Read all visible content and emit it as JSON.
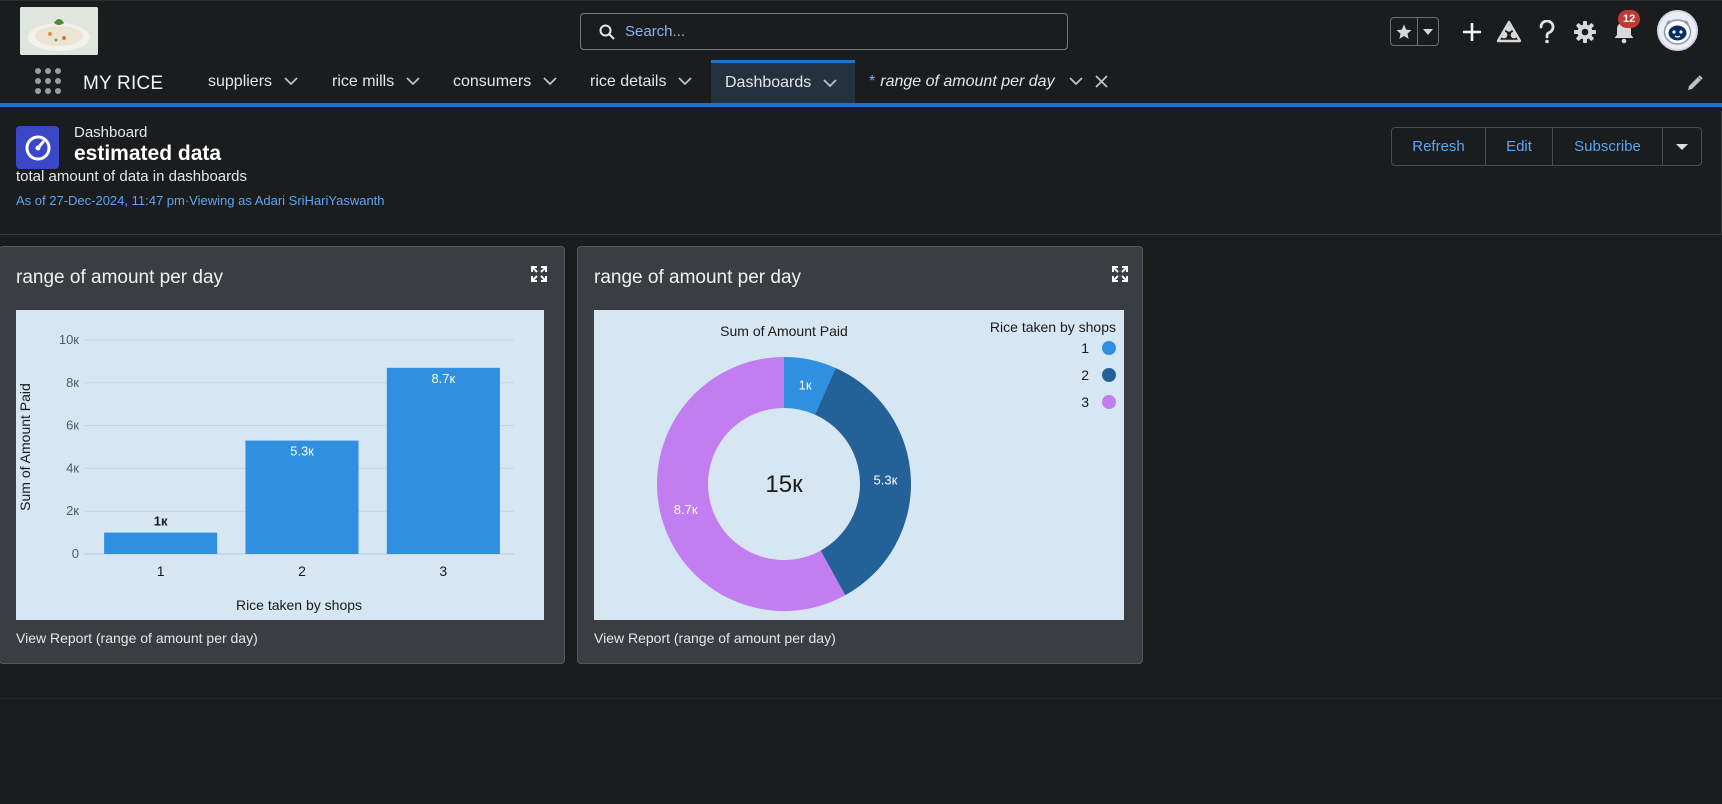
{
  "header": {
    "search_placeholder": "Search...",
    "notification_count": "12"
  },
  "nav": {
    "app_name": "MY RICE",
    "items": [
      {
        "label": "suppliers"
      },
      {
        "label": "rice mills"
      },
      {
        "label": "consumers"
      },
      {
        "label": "rice details"
      },
      {
        "label": "Dashboards"
      },
      {
        "label": "range of amount per day",
        "prefix": "*"
      }
    ]
  },
  "dashboard": {
    "type_label": "Dashboard",
    "title": "estimated data",
    "description": "total amount of data in dashboards",
    "as_of": "As of 27-Dec-2024, 11:47 pm·Viewing as Adari SriHariYaswanth",
    "buttons": {
      "refresh": "Refresh",
      "edit": "Edit",
      "subscribe": "Subscribe"
    }
  },
  "cards": [
    {
      "title": "range of amount per day",
      "link": "View Report (range of amount per day)"
    },
    {
      "title": "range of amount per day",
      "link": "View Report (range of amount per day)"
    }
  ],
  "colors": {
    "accent": "#1876d1",
    "bar": "#2f8fe0",
    "slice1": "#2f8fe0",
    "slice2": "#246199",
    "slice3": "#c27ef0",
    "chart_bg": "#d6e7f3"
  },
  "chart_data": [
    {
      "type": "bar",
      "xlabel": "Rice taken by shops",
      "ylabel": "Sum of Amount Paid",
      "categories": [
        "1",
        "2",
        "3"
      ],
      "values": [
        1000,
        5300,
        8700
      ],
      "data_labels": [
        "1к",
        "5.3к",
        "8.7к"
      ],
      "ylim": [
        0,
        10000
      ],
      "y_ticks": [
        "0",
        "2к",
        "4к",
        "6к",
        "8к",
        "10к"
      ],
      "grid": true
    },
    {
      "type": "pie",
      "subtype": "donut",
      "title": "Sum of Amount Paid",
      "legend_title": "Rice taken by shops",
      "legend_position": "top-right",
      "categories": [
        "1",
        "2",
        "3"
      ],
      "values": [
        1000,
        5300,
        8700
      ],
      "data_labels": [
        "1к",
        "5.3к",
        "8.7к"
      ],
      "center_label": "15к"
    }
  ]
}
